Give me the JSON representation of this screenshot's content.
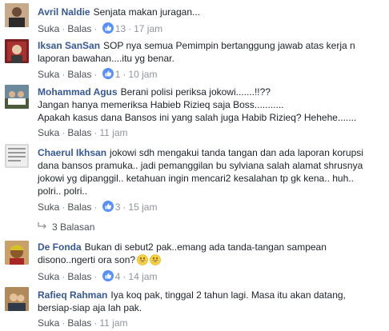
{
  "comments": [
    {
      "name": "Avril Naldie",
      "text": "Senjata makan juragan...",
      "reply": "Suka",
      "like": "Balas",
      "reactions": "13",
      "time": "17 jam"
    },
    {
      "name": "Iksan SanSan",
      "text": "SOP nya semua Pemimpin bertanggung jawab atas kerja n laporan bawahan....itu yg benar.",
      "reply": "Suka",
      "like": "Balas",
      "reactions": "1",
      "time": "10 jam"
    },
    {
      "name": "Mohammad Agus",
      "text1": "Berani polisi periksa jokowi.......!!??",
      "text2": "Jangan hanya memeriksa Habieb Rizieq saja Boss...........",
      "text3": "Apakah kasus dana Bansos ini yang salah juga Habib Rizieq? Hehehe.......",
      "reply": "Suka",
      "like": "Balas",
      "time": "11 jam"
    },
    {
      "name": "Chaerul Ikhsan",
      "text1": "jokowi sdh mengakui tanda tangan dan ada laporan korupsi",
      "text2": "dana bansos pramuka.. jadi pemanggilan bu sylviana salah alamat shrusnya",
      "text3": "jokowi yg dipanggil.. ketahuan ingin mencari2 kesalahan tp gk kena.. huh..",
      "text4": "polri.. polri..",
      "reply": "Suka",
      "like": "Balas",
      "reactions": "3",
      "time": "15 jam"
    },
    {
      "name": "De Fonda",
      "text1": "Bukan di sebut2 pak..emang ada tanda-tangan sampean",
      "text2": "disono..ngerti ora son?",
      "reply": "Suka",
      "like": "Balas",
      "reactions": "4",
      "time": "14 jam"
    },
    {
      "name": "Rafieq Rahman",
      "text1": "Iya koq pak, tinggal 2 tahun lagi. Masa itu akan datang,",
      "text2": "bersiap-siap aja lah pak.",
      "reply": "Suka",
      "like": "Balas",
      "time": "11 jam"
    }
  ],
  "replies_link": "3 Balasan",
  "colors": {
    "link": "#365899",
    "muted": "#90949c",
    "like": "#5890ff"
  }
}
